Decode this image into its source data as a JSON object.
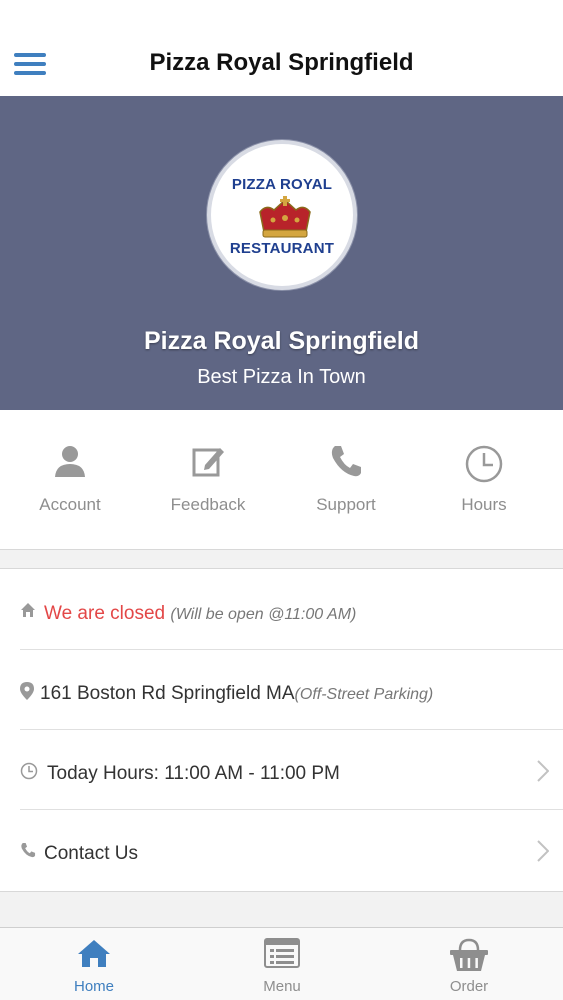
{
  "header": {
    "title": "Pizza Royal Springfield",
    "menu_icon": "hamburger-icon"
  },
  "hero": {
    "logo_top": "PIZZA ROYAL",
    "logo_bottom": "RESTAURANT",
    "title": "Pizza Royal Springfield",
    "subtitle": "Best Pizza In Town",
    "background_color": "#5f6684"
  },
  "quick_actions": [
    {
      "label": "Account",
      "icon": "user-icon"
    },
    {
      "label": "Feedback",
      "icon": "edit-icon"
    },
    {
      "label": "Support",
      "icon": "phone-icon"
    },
    {
      "label": "Hours",
      "icon": "clock-icon"
    }
  ],
  "info": {
    "status": {
      "icon": "store-icon",
      "text": "We are closed",
      "note": "(Will be open @11:00 AM)",
      "color": "#e34747"
    },
    "address": {
      "icon": "map-pin-icon",
      "text": "161 Boston Rd Springfield MA",
      "note": "(Off-Street Parking)"
    },
    "hours": {
      "icon": "clock-icon",
      "text": "Today Hours: 11:00 AM - 11:00 PM"
    },
    "contact": {
      "icon": "phone-icon",
      "text": "Contact Us"
    }
  },
  "tabs": [
    {
      "label": "Home",
      "icon": "home-icon",
      "active": true
    },
    {
      "label": "Menu",
      "icon": "menu-list-icon",
      "active": false
    },
    {
      "label": "Order",
      "icon": "basket-icon",
      "active": false
    }
  ],
  "accent_color": "#3f7fbf"
}
